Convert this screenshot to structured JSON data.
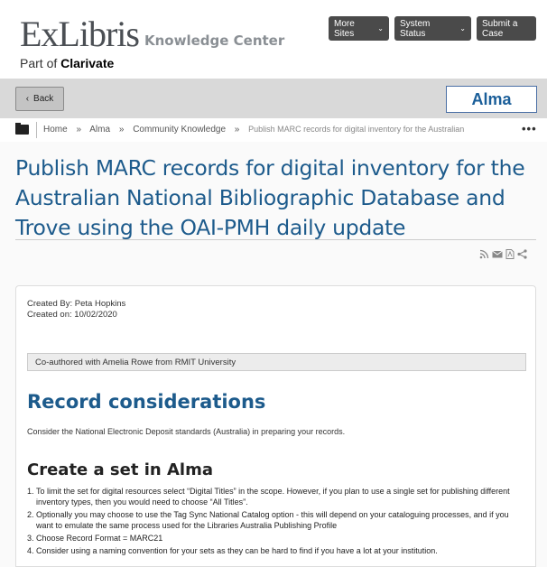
{
  "header": {
    "logo": {
      "brand": "ExLibris",
      "product": "Knowledge Center",
      "part_of_prefix": "Part of",
      "part_of_company": "Clarivate"
    },
    "more_sites": "More Sites",
    "system_status": "System Status",
    "submit_case": "Submit a Case"
  },
  "toolbar": {
    "back": "Back",
    "product_button": "Alma"
  },
  "breadcrumb": {
    "items": [
      "Home",
      "Alma",
      "Community Knowledge",
      "Publish MARC records for digital inventory for the Australian"
    ],
    "separator": "»"
  },
  "page": {
    "title": "Publish MARC records for digital inventory for the Australian National Bibliographic Database and Trove using the OAI-PMH daily update"
  },
  "article": {
    "created_by": "Created By: Peta Hopkins",
    "created_on": "Created on: 10/02/2020",
    "note": "Co-authored with Amelia Rowe from RMIT University",
    "section1_title": "Record considerations",
    "section1_text": "Consider the National Electronic Deposit standards (Australia) in preparing your records.",
    "section2_title": "Create a set in Alma",
    "list": [
      {
        "num": "1.",
        "text": "To limit the set for digital resources select “Digital Titles” in the scope. However, if you plan to use a single set for publishing different inventory types, then you would need to choose “All Titles”."
      },
      {
        "num": "2.",
        "text": "Optionally you may choose to use the Tag Sync National Catalog option - this will depend on your cataloguing processes, and if you want to emulate the same process used for the Libraries Australia Publishing Profile"
      },
      {
        "num": "3.",
        "text": "Choose Record Format = MARC21"
      },
      {
        "num": "4.",
        "text": "Consider using a naming convention for your sets as they can be hard to find if you have a lot at your institution."
      }
    ]
  },
  "icons": [
    "folder-icon",
    "rss-icon",
    "email-icon",
    "pdf-icon",
    "share-icon",
    "more-icon",
    "chevron-down-icon",
    "chevron-left-icon"
  ],
  "colors": {
    "title_blue": "#1d5b8c",
    "header_button": "#4a4a4a",
    "toolbar_gray": "#d9d9d9"
  }
}
